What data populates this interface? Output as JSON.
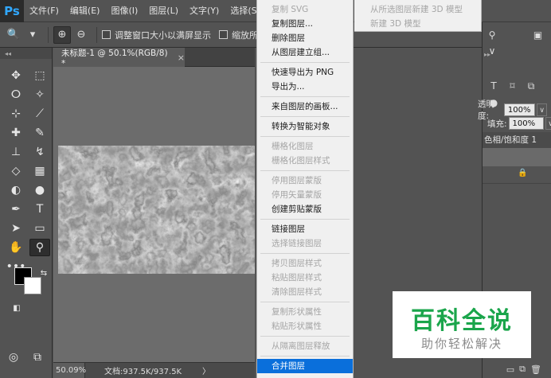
{
  "menubar": {
    "logo": "Ps",
    "items": [
      "文件(F)",
      "编辑(E)",
      "图像(I)",
      "图层(L)",
      "文字(Y)",
      "选择(S)"
    ]
  },
  "options": {
    "zoom_icon": "🔍",
    "zoom_in": "⊕",
    "zoom_out": "⊖",
    "resize_label": "调整窗口大小以满屏显示",
    "zoom_all_label": "缩放所有"
  },
  "document": {
    "tab_label": "未标题-1 @ 50.1%(RGB/8) *",
    "tab_close": "×"
  },
  "status": {
    "zoom": "50.09%",
    "doc_info": "文档:937.5K/937.5K",
    "arrow": "〉"
  },
  "context_menu": {
    "groups": [
      [
        {
          "label": "复制 SVG",
          "disabled": true
        },
        {
          "label": "复制图层...",
          "disabled": false
        },
        {
          "label": "删除图层",
          "disabled": false
        },
        {
          "label": "从图层建立组...",
          "disabled": false
        }
      ],
      [
        {
          "label": "快速导出为 PNG",
          "disabled": false
        },
        {
          "label": "导出为...",
          "disabled": false
        }
      ],
      [
        {
          "label": "来自图层的画板...",
          "disabled": false
        }
      ],
      [
        {
          "label": "转换为智能对象",
          "disabled": false
        }
      ],
      [
        {
          "label": "栅格化图层",
          "disabled": true
        },
        {
          "label": "栅格化图层样式",
          "disabled": true
        }
      ],
      [
        {
          "label": "停用图层蒙版",
          "disabled": true
        },
        {
          "label": "停用矢量蒙版",
          "disabled": true
        },
        {
          "label": "创建剪贴蒙版",
          "disabled": false
        }
      ],
      [
        {
          "label": "链接图层",
          "disabled": false
        },
        {
          "label": "选择链接图层",
          "disabled": true
        }
      ],
      [
        {
          "label": "拷贝图层样式",
          "disabled": true
        },
        {
          "label": "粘贴图层样式",
          "disabled": true
        },
        {
          "label": "清除图层样式",
          "disabled": true
        }
      ],
      [
        {
          "label": "复制形状属性",
          "disabled": true
        },
        {
          "label": "粘贴形状属性",
          "disabled": true
        }
      ],
      [
        {
          "label": "从隔离图层释放",
          "disabled": true
        }
      ],
      [
        {
          "label": "合并图层",
          "disabled": false,
          "highlight": true
        }
      ]
    ]
  },
  "submenu": {
    "items": [
      {
        "label": "从所选图层新建 3D 模型",
        "disabled": true
      },
      {
        "label": "新建 3D 模型",
        "disabled": true
      }
    ]
  },
  "right_panel": {
    "opacity_label": "透明度:",
    "opacity_value": "100%",
    "fill_label": "填充:",
    "fill_value": "100%",
    "layer_name": "色相/饱和度 1",
    "lock_icon": "🔒",
    "dropdown_icon": "∨"
  },
  "watermark": {
    "title": "百科全说",
    "subtitle": "助你轻松解决"
  },
  "colors": {
    "accent": "#31a8ff",
    "highlight": "#0a6fdb",
    "watermark_green": "#1aa54b"
  }
}
